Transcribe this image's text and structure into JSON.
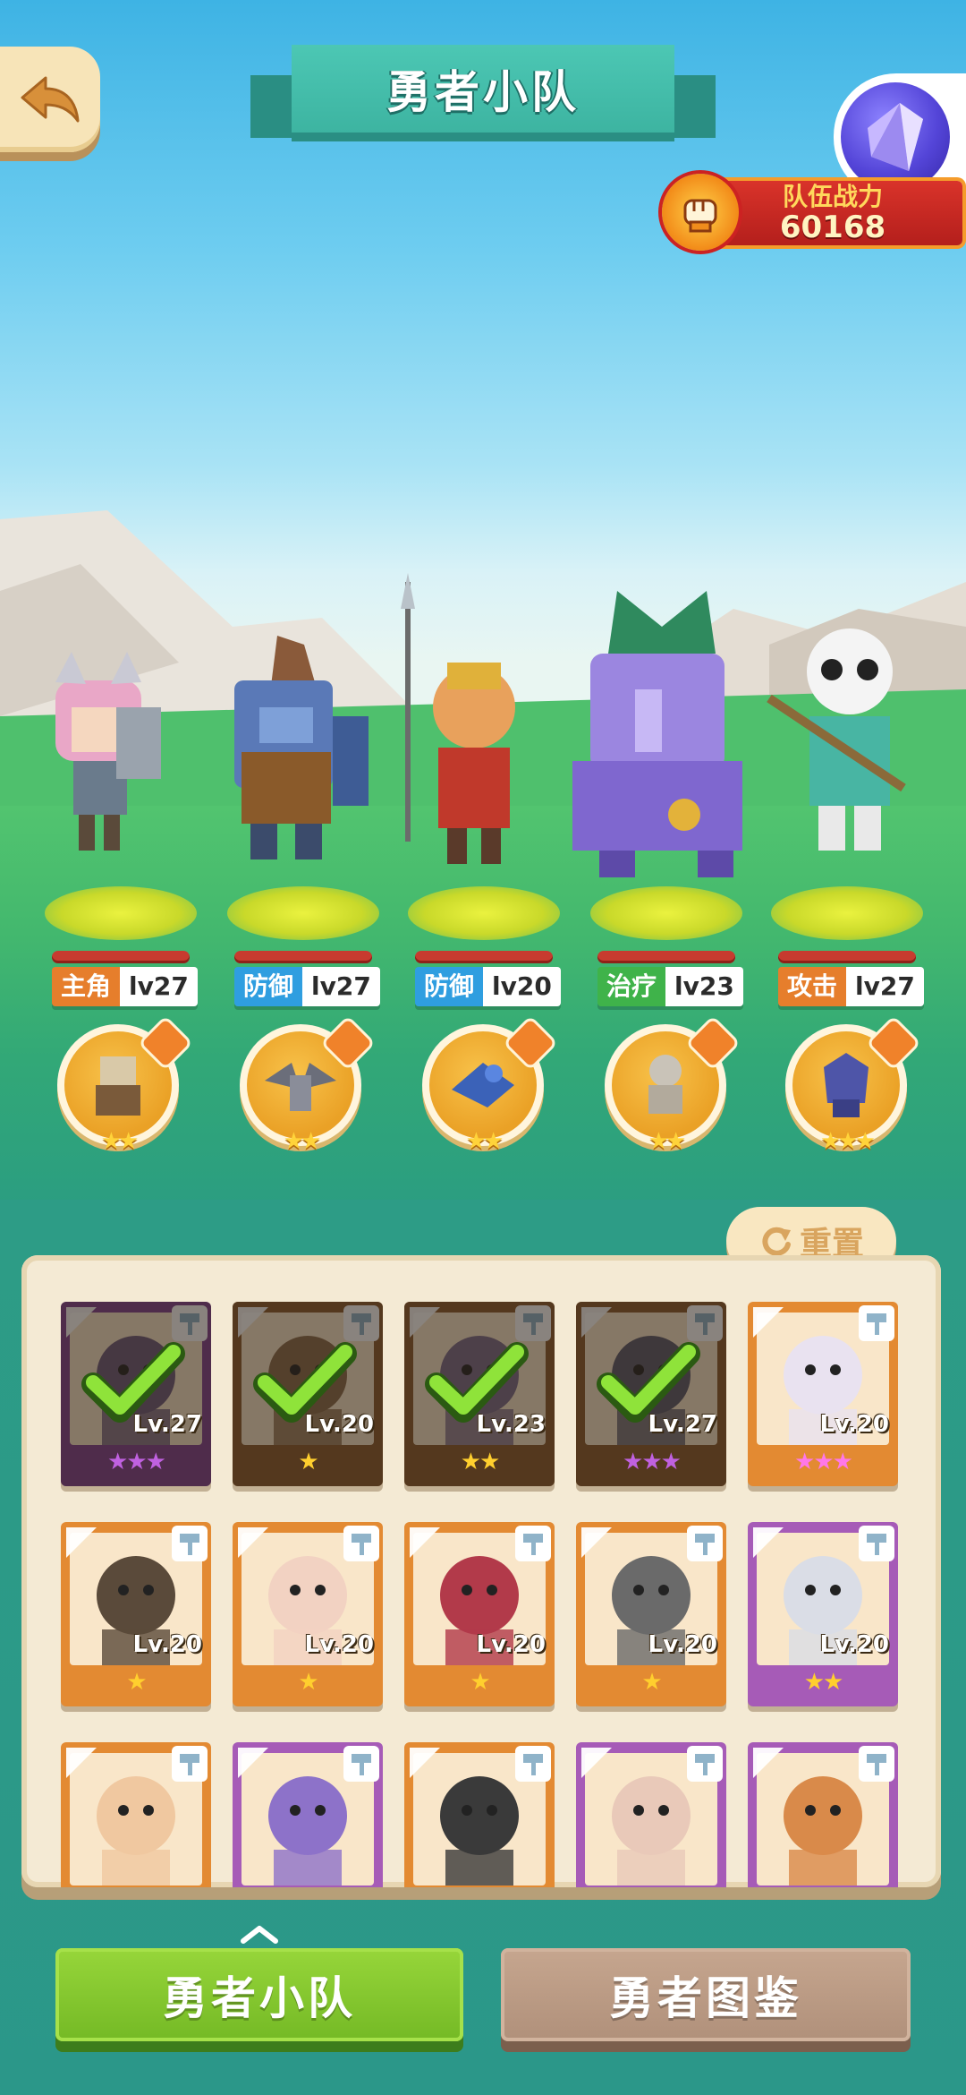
{
  "header": {
    "title": "勇者小队",
    "team_power_label": "队伍战力",
    "team_power_value": "60168"
  },
  "heroes": [
    {
      "role": "主角",
      "level": "lv27",
      "role_color": "#e67e2c",
      "pet_stars": "★★"
    },
    {
      "role": "防御",
      "level": "lv27",
      "role_color": "#2f9ee0",
      "pet_stars": "★★"
    },
    {
      "role": "防御",
      "level": "lv20",
      "role_color": "#2f9ee0",
      "pet_stars": "★★"
    },
    {
      "role": "治疗",
      "level": "lv23",
      "role_color": "#3fb34a",
      "pet_stars": "★★"
    },
    {
      "role": "攻击",
      "level": "lv27",
      "role_color": "#e67e2c",
      "pet_stars": "★★★"
    }
  ],
  "panel": {
    "reset_label": "重置",
    "cards": [
      {
        "level": "Lv.27",
        "stars": "★★★",
        "star_color": "#c061e0",
        "frame": "purple-dark",
        "in_team": true
      },
      {
        "level": "Lv.20",
        "stars": "★",
        "star_color": "#ffcf2e",
        "frame": "brown",
        "in_team": true
      },
      {
        "level": "Lv.23",
        "stars": "★★",
        "star_color": "#ffcf2e",
        "frame": "brown",
        "in_team": true
      },
      {
        "level": "Lv.27",
        "stars": "★★★",
        "star_color": "#c061e0",
        "frame": "brown",
        "in_team": true
      },
      {
        "level": "Lv.20",
        "stars": "★★★",
        "star_color": "#ff77e8",
        "frame": "orange",
        "in_team": false
      },
      {
        "level": "Lv.20",
        "stars": "★",
        "star_color": "#ffcf2e",
        "frame": "orange",
        "in_team": false
      },
      {
        "level": "Lv.20",
        "stars": "★",
        "star_color": "#ffcf2e",
        "frame": "orange",
        "in_team": false
      },
      {
        "level": "Lv.20",
        "stars": "★",
        "star_color": "#ffcf2e",
        "frame": "orange",
        "in_team": false
      },
      {
        "level": "Lv.20",
        "stars": "★",
        "star_color": "#ffcf2e",
        "frame": "orange",
        "in_team": false
      },
      {
        "level": "Lv.20",
        "stars": "★★",
        "star_color": "#ffcf2e",
        "frame": "purple",
        "in_team": false
      },
      {
        "level": "",
        "stars": "",
        "star_color": "#ffcf2e",
        "frame": "orange",
        "in_team": false
      },
      {
        "level": "",
        "stars": "",
        "star_color": "#ffcf2e",
        "frame": "purple",
        "in_team": false
      },
      {
        "level": "",
        "stars": "",
        "star_color": "#ffcf2e",
        "frame": "orange",
        "in_team": false
      },
      {
        "level": "",
        "stars": "",
        "star_color": "#ffcf2e",
        "frame": "purple",
        "in_team": false
      },
      {
        "level": "",
        "stars": "",
        "star_color": "#ffcf2e",
        "frame": "purple",
        "in_team": false
      }
    ]
  },
  "tabs": {
    "team_label": "勇者小队",
    "codex_label": "勇者图鉴"
  },
  "colors": {
    "accent_green": "#74b925",
    "title_teal": "#3db4a1",
    "power_red": "#b41f1c"
  }
}
